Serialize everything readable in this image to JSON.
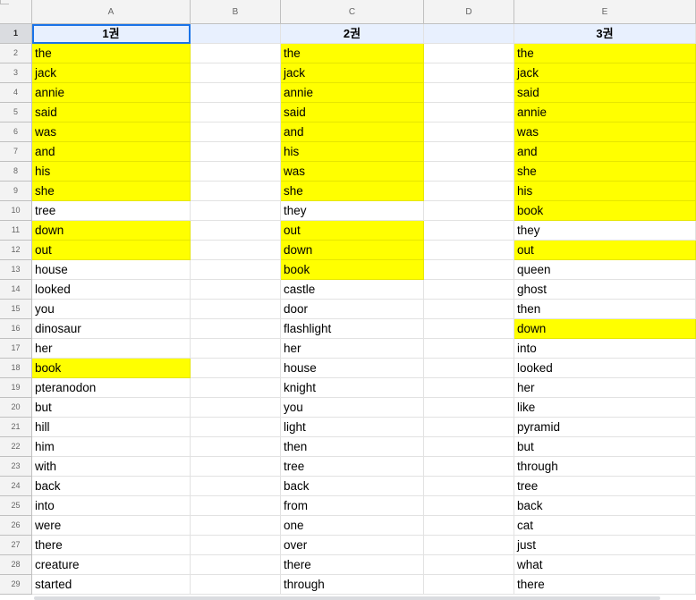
{
  "columns": [
    "A",
    "B",
    "C",
    "D",
    "E"
  ],
  "header_row": {
    "row_number": "1",
    "A": "1권",
    "B": "",
    "C": "2권",
    "D": "",
    "E": "3권"
  },
  "rows": [
    {
      "n": "2",
      "A": "the",
      "A_hl": true,
      "C": "the",
      "C_hl": true,
      "E": "the",
      "E_hl": true
    },
    {
      "n": "3",
      "A": "jack",
      "A_hl": true,
      "C": "jack",
      "C_hl": true,
      "E": "jack",
      "E_hl": true
    },
    {
      "n": "4",
      "A": "annie",
      "A_hl": true,
      "C": "annie",
      "C_hl": true,
      "E": "said",
      "E_hl": true
    },
    {
      "n": "5",
      "A": "said",
      "A_hl": true,
      "C": "said",
      "C_hl": true,
      "E": "annie",
      "E_hl": true
    },
    {
      "n": "6",
      "A": "was",
      "A_hl": true,
      "C": "and",
      "C_hl": true,
      "E": "was",
      "E_hl": true
    },
    {
      "n": "7",
      "A": "and",
      "A_hl": true,
      "C": "his",
      "C_hl": true,
      "E": "and",
      "E_hl": true
    },
    {
      "n": "8",
      "A": "his",
      "A_hl": true,
      "C": "was",
      "C_hl": true,
      "E": "she",
      "E_hl": true
    },
    {
      "n": "9",
      "A": "she",
      "A_hl": true,
      "C": "she",
      "C_hl": true,
      "E": "his",
      "E_hl": true
    },
    {
      "n": "10",
      "A": "tree",
      "A_hl": false,
      "C": "they",
      "C_hl": false,
      "E": "book",
      "E_hl": true
    },
    {
      "n": "11",
      "A": "down",
      "A_hl": true,
      "C": "out",
      "C_hl": true,
      "E": "they",
      "E_hl": false
    },
    {
      "n": "12",
      "A": "out",
      "A_hl": true,
      "C": "down",
      "C_hl": true,
      "E": "out",
      "E_hl": true
    },
    {
      "n": "13",
      "A": "house",
      "A_hl": false,
      "C": "book",
      "C_hl": true,
      "E": "queen",
      "E_hl": false
    },
    {
      "n": "14",
      "A": "looked",
      "A_hl": false,
      "C": "castle",
      "C_hl": false,
      "E": "ghost",
      "E_hl": false
    },
    {
      "n": "15",
      "A": "you",
      "A_hl": false,
      "C": "door",
      "C_hl": false,
      "E": "then",
      "E_hl": false
    },
    {
      "n": "16",
      "A": "dinosaur",
      "A_hl": false,
      "C": "flashlight",
      "C_hl": false,
      "E": "down",
      "E_hl": true
    },
    {
      "n": "17",
      "A": "her",
      "A_hl": false,
      "C": "her",
      "C_hl": false,
      "E": "into",
      "E_hl": false
    },
    {
      "n": "18",
      "A": "book",
      "A_hl": true,
      "C": "house",
      "C_hl": false,
      "E": "looked",
      "E_hl": false
    },
    {
      "n": "19",
      "A": "pteranodon",
      "A_hl": false,
      "C": "knight",
      "C_hl": false,
      "E": "her",
      "E_hl": false
    },
    {
      "n": "20",
      "A": "but",
      "A_hl": false,
      "C": "you",
      "C_hl": false,
      "E": "like",
      "E_hl": false
    },
    {
      "n": "21",
      "A": "hill",
      "A_hl": false,
      "C": "light",
      "C_hl": false,
      "E": "pyramid",
      "E_hl": false
    },
    {
      "n": "22",
      "A": "him",
      "A_hl": false,
      "C": "then",
      "C_hl": false,
      "E": "but",
      "E_hl": false
    },
    {
      "n": "23",
      "A": "with",
      "A_hl": false,
      "C": "tree",
      "C_hl": false,
      "E": "through",
      "E_hl": false
    },
    {
      "n": "24",
      "A": "back",
      "A_hl": false,
      "C": "back",
      "C_hl": false,
      "E": "tree",
      "E_hl": false
    },
    {
      "n": "25",
      "A": "into",
      "A_hl": false,
      "C": "from",
      "C_hl": false,
      "E": "back",
      "E_hl": false
    },
    {
      "n": "26",
      "A": "were",
      "A_hl": false,
      "C": "one",
      "C_hl": false,
      "E": "cat",
      "E_hl": false
    },
    {
      "n": "27",
      "A": "there",
      "A_hl": false,
      "C": "over",
      "C_hl": false,
      "E": "just",
      "E_hl": false
    },
    {
      "n": "28",
      "A": "creature",
      "A_hl": false,
      "C": "there",
      "C_hl": false,
      "E": "what",
      "E_hl": false
    },
    {
      "n": "29",
      "A": "started",
      "A_hl": false,
      "C": "through",
      "C_hl": false,
      "E": "there",
      "E_hl": false
    }
  ],
  "colors": {
    "highlight": "#ffff00",
    "header_fill": "#e8f0fe",
    "selection": "#1a73e8"
  }
}
